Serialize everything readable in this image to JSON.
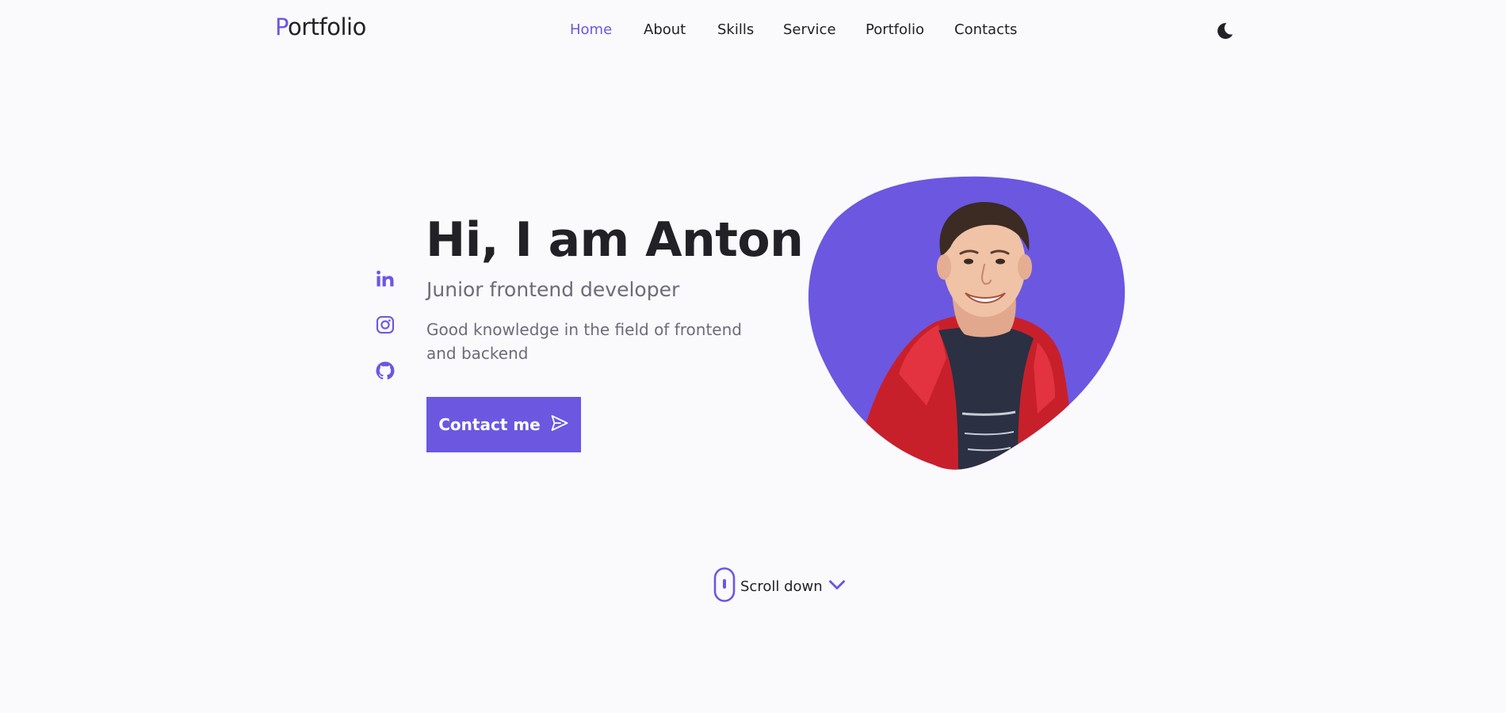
{
  "header": {
    "logo_initial": "P",
    "logo_rest": "ortfolio",
    "nav": [
      {
        "label": "Home",
        "active": true
      },
      {
        "label": "About",
        "active": false
      },
      {
        "label": "Skills",
        "active": false
      },
      {
        "label": "Service",
        "active": false
      },
      {
        "label": "Portfolio",
        "active": false
      },
      {
        "label": "Contacts",
        "active": false
      }
    ],
    "theme_icon": "moon-icon"
  },
  "social": [
    {
      "icon": "linkedin-icon"
    },
    {
      "icon": "instagram-icon"
    },
    {
      "icon": "github-icon"
    }
  ],
  "hero": {
    "title": "Hi, I am Anton",
    "subtitle": "Junior frontend developer",
    "description": "Good knowledge in the field of frontend and backend",
    "button_label": "Contact me",
    "button_icon": "send-icon",
    "image_icon": "profile-photo"
  },
  "scroll": {
    "label": "Scroll down",
    "mouse_icon": "mouse-icon",
    "arrow_icon": "chevron-down-icon"
  },
  "colors": {
    "accent": "#6c57e1",
    "text": "#222126",
    "muted_text": "#6e6b78",
    "background": "#faf9fc"
  }
}
